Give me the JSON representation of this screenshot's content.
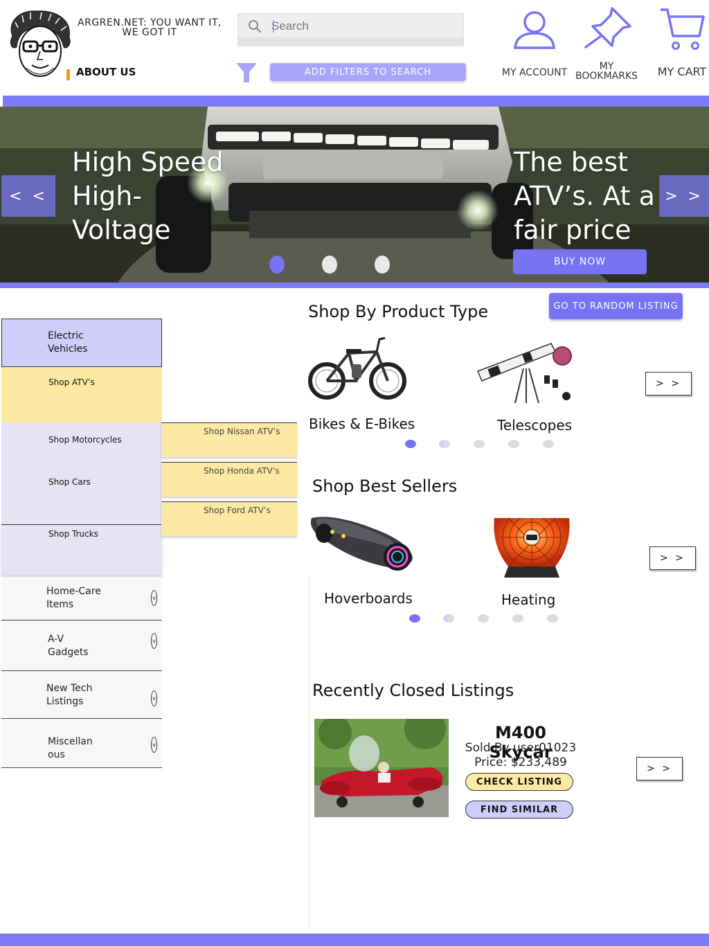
{
  "header": {
    "site_title": "ARGREN.NET: YOU WANT IT, WE GOT IT",
    "about_label": "ABOUT US",
    "search_placeholder": "Search",
    "filter_button": "ADD FILTERS TO SEARCH",
    "nav": [
      {
        "label": "MY ACCOUNT",
        "icon": "user-icon"
      },
      {
        "label": "MY BOOKMARKS",
        "icon": "pin-icon"
      },
      {
        "label": "MY CART",
        "icon": "cart-icon"
      }
    ]
  },
  "hero": {
    "left_text": "High Speed High-Voltage",
    "right_text": "The best ATV’s. At a fair price",
    "prev_label": "< <",
    "next_label": "> >",
    "buy_button": "BUY NOW",
    "slide_count": 3,
    "active_slide": 1
  },
  "sidebar": {
    "electric_vehicles": "Electric Vehicles",
    "sub_items": [
      "Shop ATV’s",
      "Shop Motorcycles",
      "Shop Cars",
      "Shop Trucks"
    ],
    "atv_brands": [
      "Shop Nissan ATV’s",
      "Shop Honda ATV’s",
      "Shop Ford ATV’s"
    ],
    "categories": [
      "Home-Care Items",
      "A-V Gadgets",
      "New Tech Listings",
      "Miscellan ous"
    ],
    "chevron": "v"
  },
  "main": {
    "random_button": "GO TO RANDOM LISTING",
    "product_type": {
      "title": "Shop By Product Type",
      "items": [
        "Bikes & E-Bikes",
        "Telescopes"
      ],
      "next_label": "> >",
      "dots": 5,
      "active_dot": 1
    },
    "best_sellers": {
      "title": "Shop Best Sellers",
      "items": [
        "Hoverboards",
        "Heating"
      ],
      "next_label": "> >",
      "dots": 5,
      "active_dot": 1
    },
    "recently_closed": {
      "title": "Recently Closed Listings",
      "listing_title": "M400 Skycar",
      "sold_by": "Sold By user01023",
      "price": "Price: $233,489",
      "check_button": "CHECK LISTING",
      "similar_button": "FIND SIMILAR",
      "next_label": "> >"
    }
  },
  "colors": {
    "accent": "#7b7bf7",
    "accent_light": "#a7a6fa",
    "lavender": "#cfcdf9",
    "yellow": "#fde9a3"
  }
}
